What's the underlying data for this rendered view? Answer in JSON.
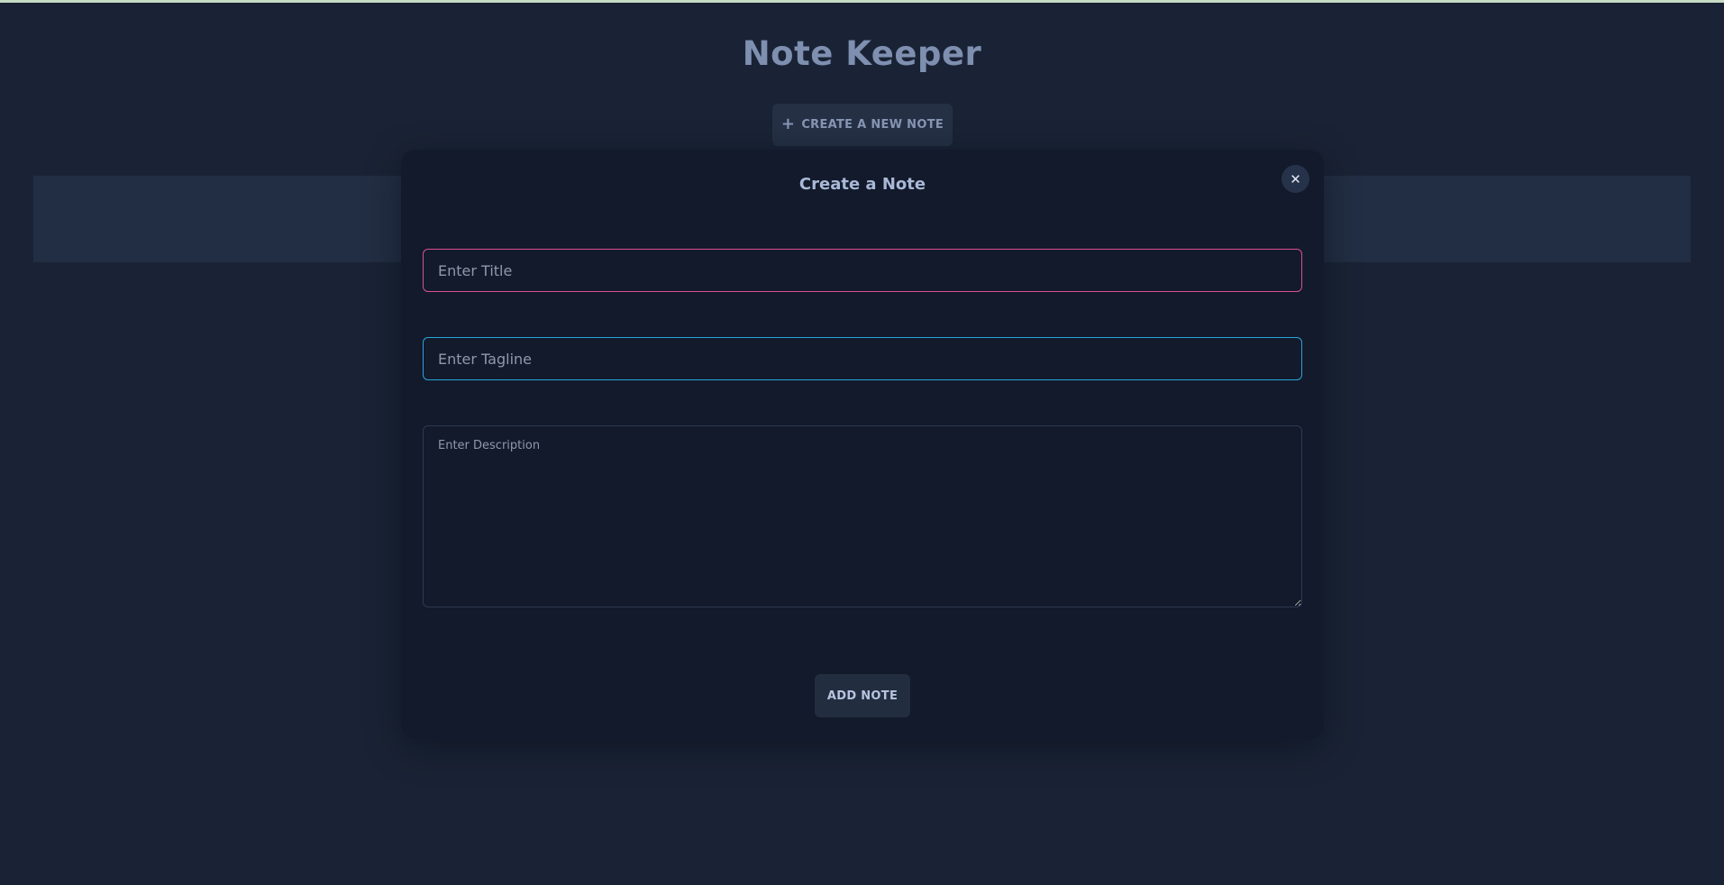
{
  "header": {
    "title": "Note Keeper",
    "create_button_label": "CREATE A NEW NOTE",
    "create_button_icon": "plus-icon"
  },
  "modal": {
    "title": "Create a Note",
    "close_icon": "close-icon",
    "title_input": {
      "placeholder": "Enter Title",
      "value": ""
    },
    "tagline_input": {
      "placeholder": "Enter Tagline",
      "value": ""
    },
    "description_input": {
      "placeholder": "Enter Description",
      "value": ""
    },
    "add_button_label": "ADD NOTE"
  },
  "colors": {
    "background": "#1a2335",
    "modal_background": "#121a2b",
    "title_border": "#d9508f",
    "tagline_border": "#2aa4dc",
    "accent_text": "#7e8fb0"
  }
}
